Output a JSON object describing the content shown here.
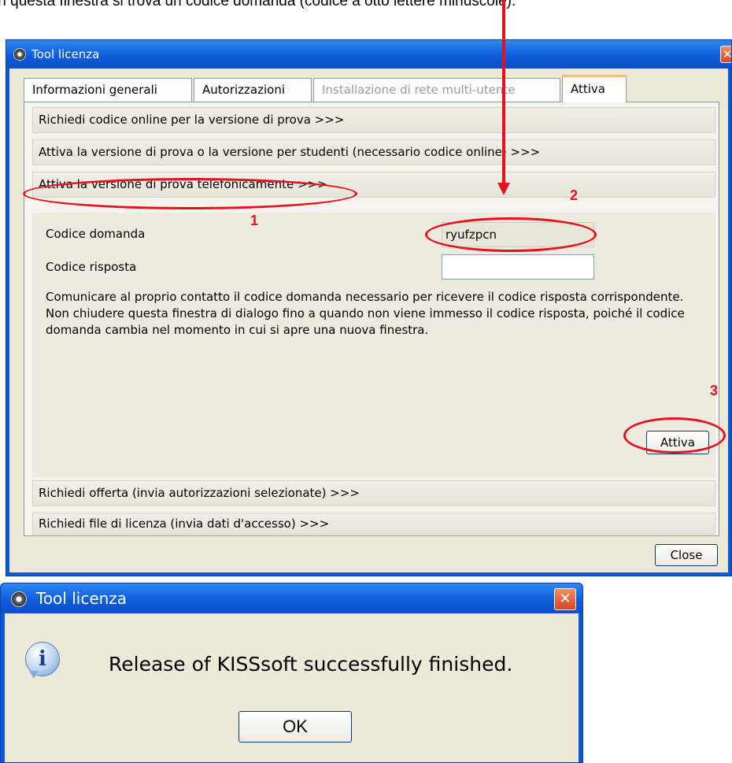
{
  "caption": "In questa finestra si trova un codice domanda (codice a otto lettere minuscole).",
  "dialog": {
    "title": "Tool licenza",
    "close_glyph": "✕",
    "tabs": [
      {
        "label": "Informazioni generali",
        "state": "normal"
      },
      {
        "label": "Autorizzazioni",
        "state": "normal"
      },
      {
        "label": "Installazione di rete multi-utente",
        "state": "disabled"
      },
      {
        "label": "Attiva",
        "state": "active"
      }
    ],
    "sections": {
      "request_online_code": "Richiedi codice online per la versione di prova >>>",
      "activate_trial_student": "Attiva la versione di prova o la versione per studenti (necessario codice online) >>>",
      "activate_by_phone": "Attiva la versione di prova telefonicamente >>>",
      "request_offer": "Richiedi offerta (invia autorizzazioni selezionate) >>>",
      "request_license_file": "Richiedi file di licenza (invia dati d'accesso) >>>"
    },
    "phone_activation": {
      "request_code_label": "Codice domanda",
      "request_code_value": "ryufzpcn",
      "response_code_label": "Codice risposta",
      "response_code_value": "",
      "description": "Comunicare al proprio contatto il codice domanda necessario per ricevere il codice risposta corrispondente. Non chiudere questa finestra di dialogo fino a quando non viene immesso il codice risposta, poiché il codice domanda cambia nel momento in cui si apre una nuova finestra.",
      "activate_button": "Attiva"
    },
    "close_button": "Close"
  },
  "annotations": {
    "color": "#e8101a",
    "labels": [
      "1",
      "2",
      "3"
    ]
  },
  "message_box": {
    "title": "Tool licenza",
    "close_glyph": "✕",
    "icon": "info-icon",
    "icon_glyph": "i",
    "message": "Release of KISSsoft successfully finished.",
    "ok_button": "OK"
  }
}
